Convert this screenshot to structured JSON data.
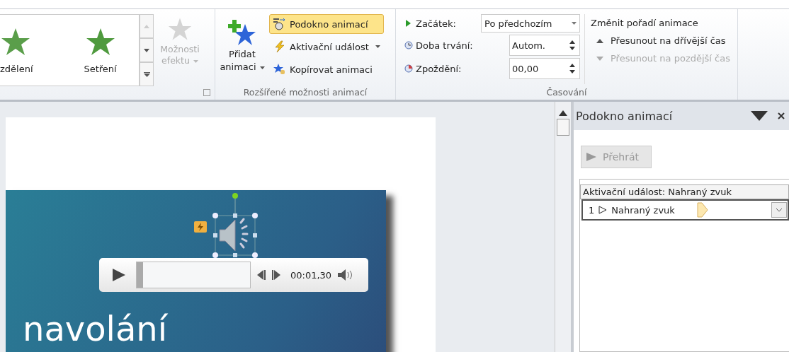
{
  "ribbon": {
    "gallery": [
      {
        "label": "zdělení",
        "kind": "split"
      },
      {
        "label": "Setření",
        "kind": "wipe"
      }
    ],
    "effect_options": {
      "label": "Možnosti efektu",
      "disabled": true
    },
    "add_animation": "Přidat animaci",
    "advanced_buttons": [
      {
        "label": "Podokno animací",
        "selected": true,
        "dropdown": false,
        "kind": "pane"
      },
      {
        "label": "Aktivační událost",
        "selected": false,
        "dropdown": true,
        "kind": "trigger"
      },
      {
        "label": "Kopírovat animaci",
        "selected": false,
        "dropdown": false,
        "kind": "painter"
      }
    ],
    "advanced_group_label": "Rozšířené možnosti animací",
    "timing": {
      "start_label": "Začátek:",
      "start_value": "Po předchozím",
      "duration_label": "Doba trvání:",
      "duration_value": "Autom.",
      "delay_label": "Zpoždění:",
      "delay_value": "00,00",
      "reorder_title": "Změnit pořadí animace",
      "move_earlier": {
        "label": "Přesunout na dřívější čas",
        "disabled": false
      },
      "move_later": {
        "label": "Přesunout na pozdější čas",
        "disabled": true
      },
      "group_label": "Časování"
    }
  },
  "slide": {
    "title": "navolání",
    "player_time": "00:01,30"
  },
  "pane": {
    "title": "Podokno animací",
    "play_button": {
      "label": "Přehrát",
      "disabled": true
    },
    "trigger_header": "Aktivační událost: Nahraný zvuk",
    "items": [
      {
        "number": "1",
        "name": "Nahraný zvuk",
        "selected": true
      }
    ]
  }
}
